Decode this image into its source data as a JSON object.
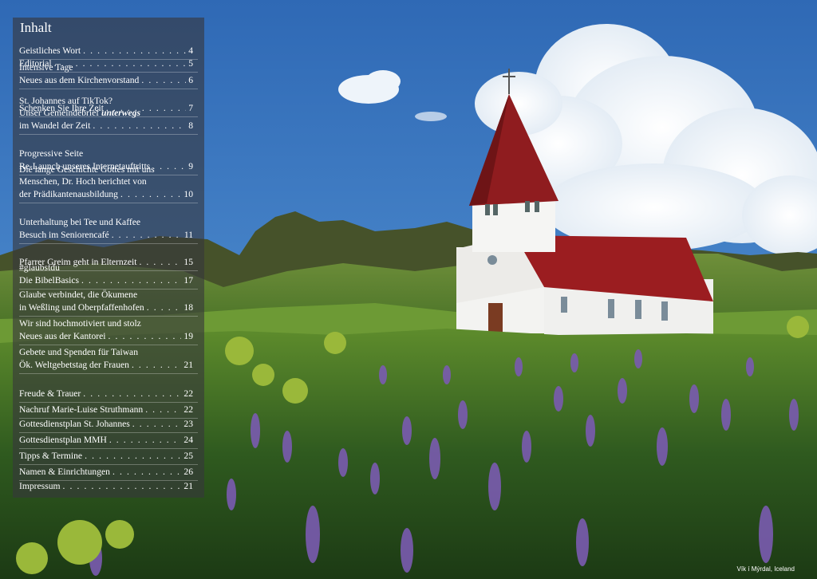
{
  "toc": {
    "title": "Inhalt",
    "entries": [
      {
        "lines": [],
        "last": "Geistliches Wort",
        "page": "4"
      },
      {
        "lines": [],
        "last": "Editorial",
        "page": "5"
      },
      {
        "lines": [
          "Intensive Tage"
        ],
        "last": "Neues aus dem Kirchenvorstand",
        "page": "6"
      },
      {
        "lines": [],
        "last": "Schenken Sie Ihre Zeit",
        "page": "7"
      },
      {
        "lines": [
          "St. Johannes auf TikTok?",
          "Unser Gemeindebrief unterwegs"
        ],
        "last": "im Wandel der Zeit",
        "page": "8"
      },
      {
        "lines": [
          "Progressive Seite"
        ],
        "last": "Re-Launch unseres Internetauftritts",
        "page": "9"
      },
      {
        "lines": [
          "Die lange Geschichte Gottes mit uns",
          "Menschen, Dr. Hoch berichtet von"
        ],
        "last": "der Prädikantenausbildung",
        "page": "10"
      },
      {
        "lines": [
          "Unterhaltung bei Tee und Kaffee"
        ],
        "last": "Besuch im Seniorencafé",
        "page": "11"
      },
      {
        "lines": [],
        "last": "Pfarrer Greim geht in Elternzeit",
        "page": "15"
      },
      {
        "lines": [
          "#glaubstdu"
        ],
        "last": "Die BibelBasics",
        "page": "17"
      },
      {
        "lines": [
          "Glaube verbindet, die Ökumene"
        ],
        "last": "in Weßling und Oberpfaffenhofen",
        "page": "18"
      },
      {
        "lines": [
          "Wir sind hochmotiviert und stolz"
        ],
        "last": "Neues aus der Kantorei",
        "page": "19"
      },
      {
        "lines": [
          "Gebete und Spenden für Taiwan"
        ],
        "last": "Ök. Weltgebetstag der Frauen",
        "page": "21"
      },
      {
        "lines": [],
        "last": "Freude & Trauer",
        "page": "22"
      },
      {
        "lines": [],
        "last": "Nachruf Marie-Luise Struthmann",
        "page": "22"
      },
      {
        "lines": [],
        "last": "Gottesdienstplan St. Johannes",
        "page": "23"
      },
      {
        "lines": [],
        "last": "Gottesdienstplan MMH",
        "page": "24"
      },
      {
        "lines": [],
        "last": "Tipps & Termine",
        "page": "25"
      },
      {
        "lines": [],
        "last": "Namen & Einrichtungen",
        "page": "26"
      },
      {
        "lines": [],
        "last": "Impressum",
        "page": "21"
      }
    ],
    "emphasis_word": "unterwegs"
  },
  "photo": {
    "caption": "Vík í Mýrdal, Iceland",
    "colors": {
      "sky": "#3f7cc4",
      "roof": "#9b1d20",
      "church_wall": "#f3f3f1",
      "meadow": "#5c8a2a",
      "lupine": "#7a5bb0",
      "mountain": "#4b5a2c"
    }
  }
}
